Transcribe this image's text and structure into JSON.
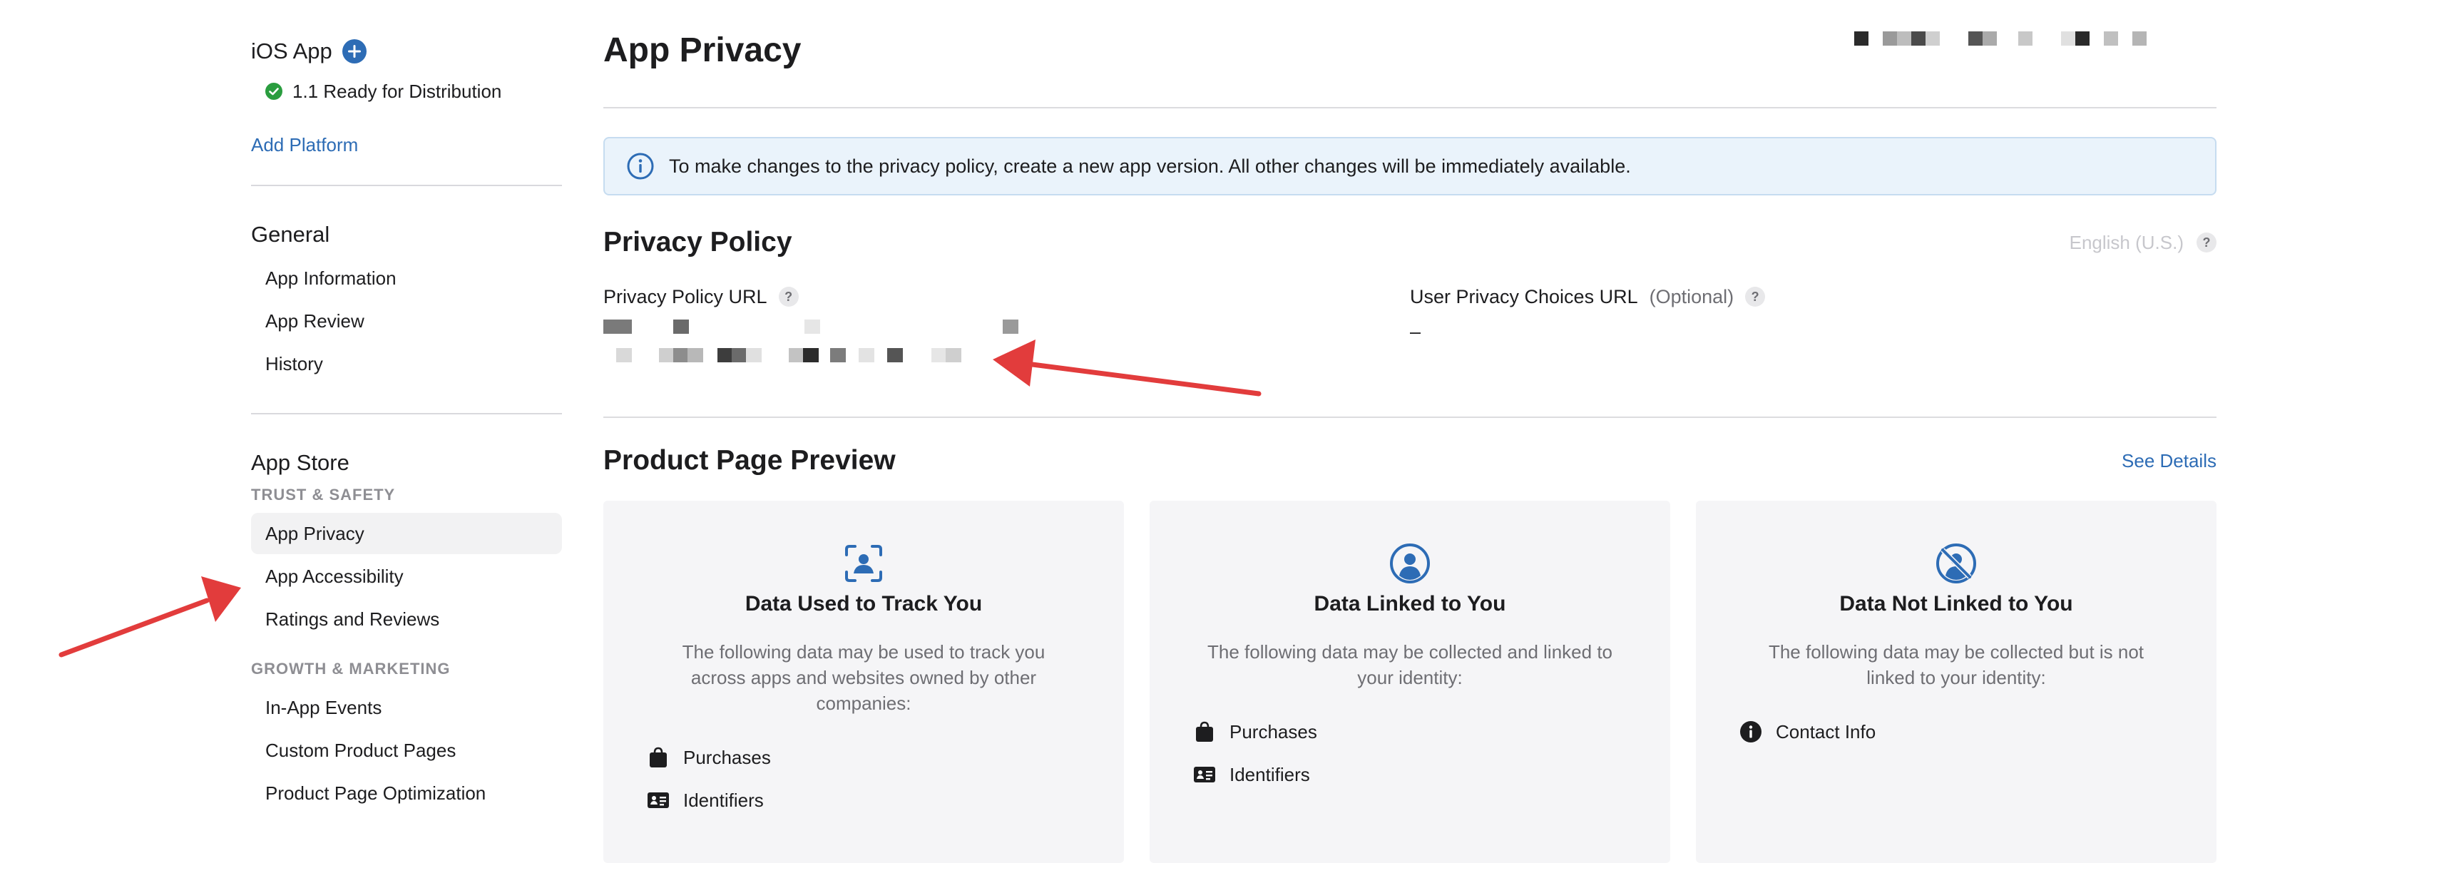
{
  "sidebar": {
    "platform": "iOS App",
    "version": "1.1 Ready for Distribution",
    "add_platform": "Add Platform",
    "general": {
      "title": "General",
      "items": [
        {
          "label": "App Information"
        },
        {
          "label": "App Review"
        },
        {
          "label": "History"
        }
      ]
    },
    "app_store": {
      "title": "App Store",
      "trust_label": "TRUST & SAFETY",
      "trust_items": [
        {
          "label": "App Privacy",
          "active": true
        },
        {
          "label": "App Accessibility"
        },
        {
          "label": "Ratings and Reviews"
        }
      ],
      "growth_label": "GROWTH & MARKETING",
      "growth_items": [
        {
          "label": "In-App Events"
        },
        {
          "label": "Custom Product Pages"
        },
        {
          "label": "Product Page Optimization"
        }
      ]
    }
  },
  "main": {
    "title": "App Privacy",
    "info_banner": "To make changes to the privacy policy, create a new app version. All other changes will be immediately available.",
    "privacy_policy": {
      "title": "Privacy Policy",
      "language": "English (U.S.)",
      "help": "?",
      "url_label": "Privacy Policy URL",
      "choices_label": "User Privacy Choices URL",
      "choices_optional": "(Optional)",
      "choices_value": "–"
    },
    "preview": {
      "title": "Product Page Preview",
      "see_details": "See Details",
      "cards": [
        {
          "icon": "track-icon",
          "title": "Data Used to Track You",
          "desc": "The following data may be used to track you across apps and websites owned by other companies:",
          "items": [
            {
              "icon": "bag-icon",
              "label": "Purchases"
            },
            {
              "icon": "id-card-icon",
              "label": "Identifiers"
            }
          ]
        },
        {
          "icon": "person-circle-icon",
          "title": "Data Linked to You",
          "desc": "The following data may be collected and linked to your identity:",
          "items": [
            {
              "icon": "bag-icon",
              "label": "Purchases"
            },
            {
              "icon": "id-card-icon",
              "label": "Identifiers"
            }
          ]
        },
        {
          "icon": "person-slash-icon",
          "title": "Data Not Linked to You",
          "desc": "The following data may be collected but is not linked to your identity:",
          "items": [
            {
              "icon": "info-fill-icon",
              "label": "Contact Info"
            }
          ]
        }
      ]
    }
  },
  "colors": {
    "accent": "#2d6cb5",
    "success": "#2a9d3f",
    "banner_bg": "#eaf3fb",
    "card_bg": "#f5f5f7",
    "annotation": "#e23c3c"
  }
}
